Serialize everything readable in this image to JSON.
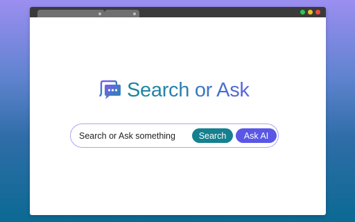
{
  "window": {
    "tabs": [
      {
        "label": ""
      },
      {
        "label": ""
      }
    ],
    "controls": [
      "green",
      "yellow",
      "red"
    ]
  },
  "brand": {
    "name": "Search or Ask",
    "icon": "chat-bubbles-icon",
    "colors": {
      "teal": "#18869a",
      "purple": "#5b63e3"
    }
  },
  "search": {
    "placeholder": "Search or Ask something",
    "value": "",
    "search_label": "Search",
    "ask_label": "Ask AI",
    "colors": {
      "search_button": "#15808f",
      "ask_button": "#5a56e6",
      "border": "#a8a6ef"
    }
  }
}
